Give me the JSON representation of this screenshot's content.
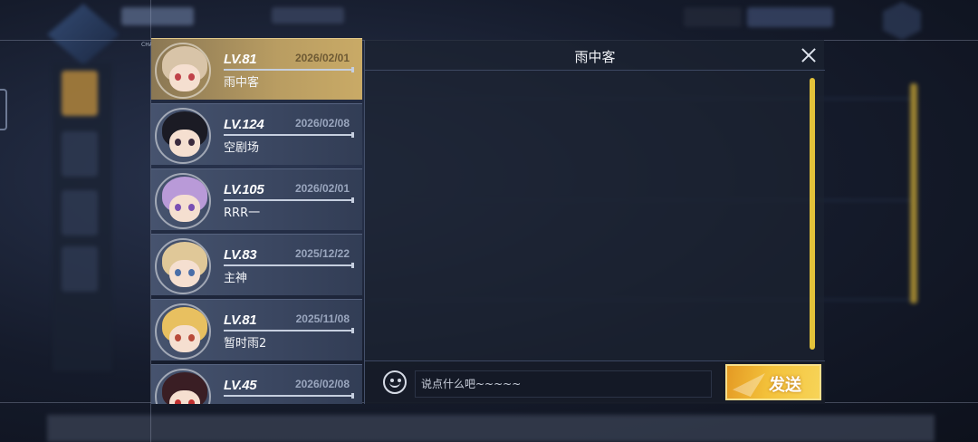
{
  "chat_panel": {
    "title": "雨中客",
    "input_placeholder": "说点什么吧~~~~~",
    "send_label": "发送"
  },
  "side_tag": "CHAT",
  "friends": [
    {
      "level": "LV.81",
      "date": "2026/02/01",
      "name": "雨中客",
      "selected": true,
      "hair_color": "#d8c4a8",
      "eye_color": "#c0424a"
    },
    {
      "level": "LV.124",
      "date": "2026/02/08",
      "name": "空剧场",
      "selected": false,
      "hair_color": "#1b1b24",
      "eye_color": "#3a2a3e"
    },
    {
      "level": "LV.105",
      "date": "2026/02/01",
      "name": "RRR一",
      "selected": false,
      "hair_color": "#b99ad8",
      "eye_color": "#7a4fb3"
    },
    {
      "level": "LV.83",
      "date": "2025/12/22",
      "name": "主神",
      "selected": false,
      "hair_color": "#e0c898",
      "eye_color": "#4a6ea8"
    },
    {
      "level": "LV.81",
      "date": "2025/11/08",
      "name": "暂时雨2",
      "selected": false,
      "hair_color": "#e8c060",
      "eye_color": "#b84a3a"
    },
    {
      "level": "LV.45",
      "date": "2026/02/08",
      "name": "",
      "selected": false,
      "hair_color": "#3a1e24",
      "eye_color": "#c03030"
    }
  ],
  "colors": {
    "accent": "#e3c23a",
    "selected_row": "#b99d62",
    "panel": "#1c2230"
  }
}
